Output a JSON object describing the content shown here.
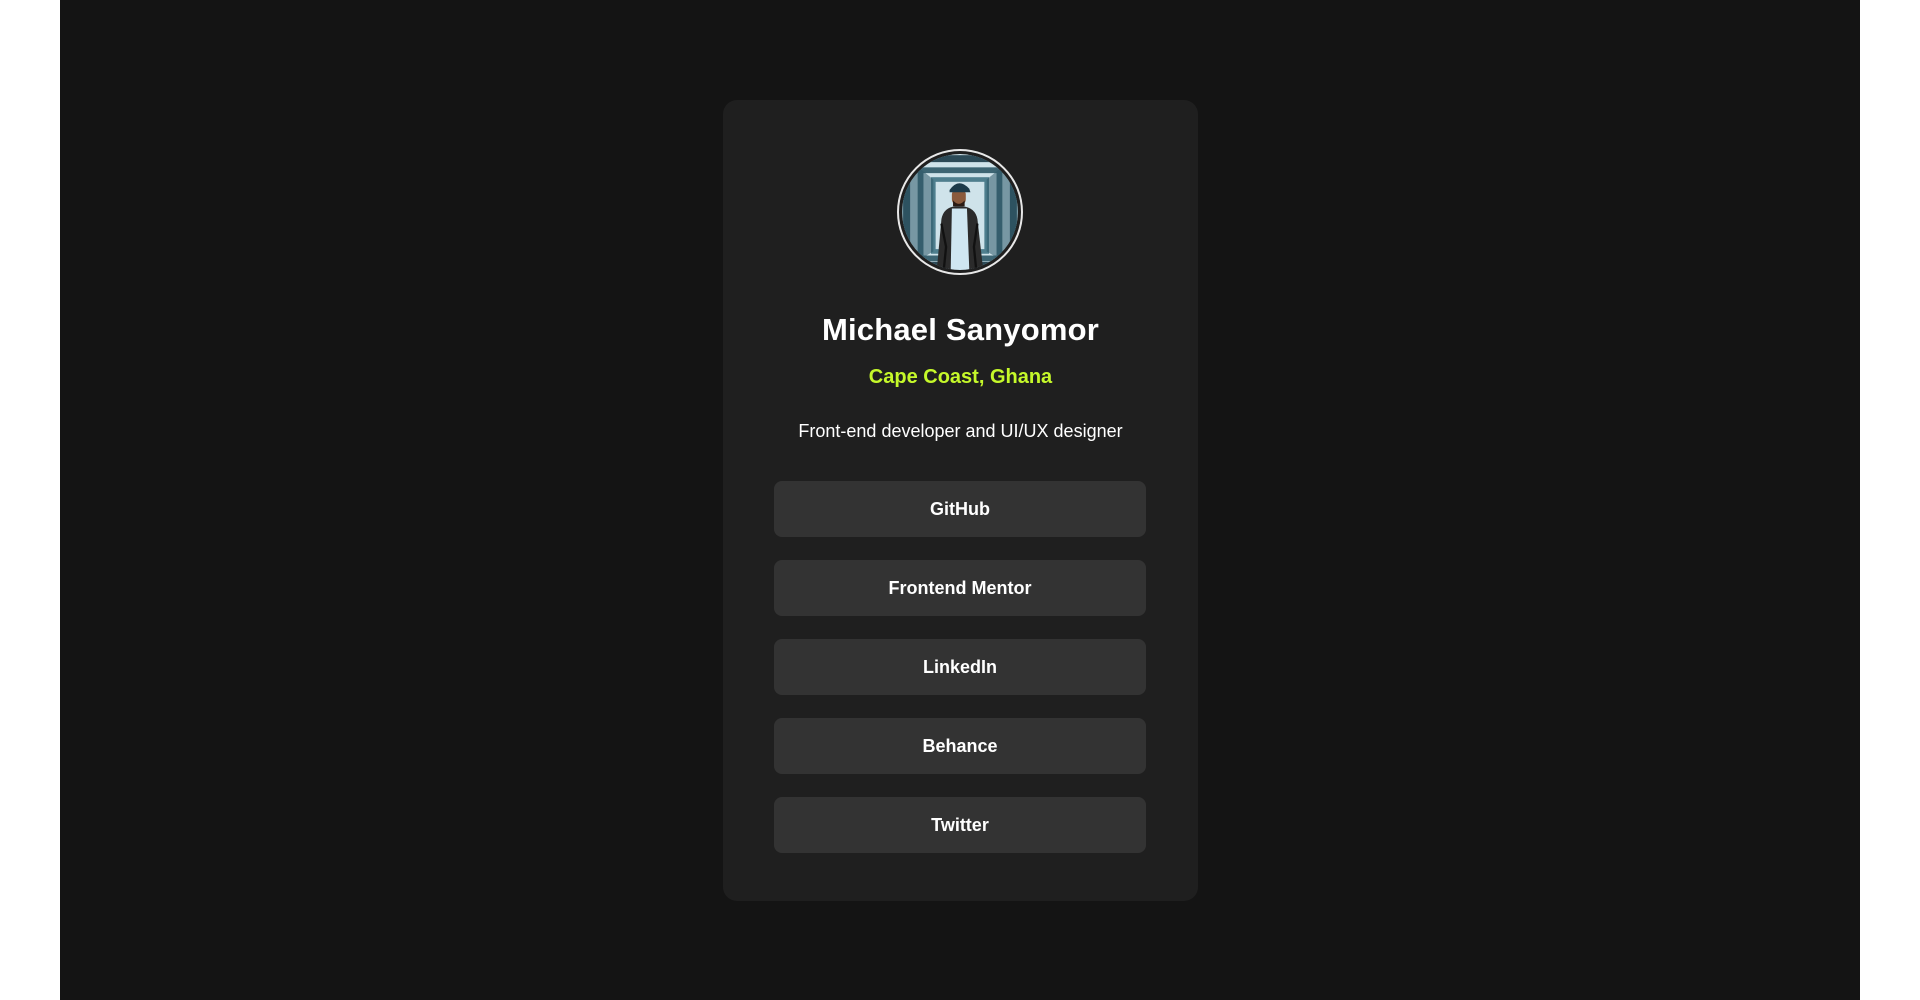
{
  "profile": {
    "name": "Michael Sanyomor",
    "location": "Cape Coast, Ghana",
    "bio": "Front-end developer and UI/UX designer"
  },
  "links": [
    {
      "label": "GitHub"
    },
    {
      "label": "Frontend Mentor"
    },
    {
      "label": "LinkedIn"
    },
    {
      "label": "Behance"
    },
    {
      "label": "Twitter"
    }
  ],
  "colors": {
    "page_background": "#141414",
    "card_background": "#1f1f1f",
    "button_background": "#333333",
    "accent": "#c5f82a",
    "text": "#ffffff"
  }
}
